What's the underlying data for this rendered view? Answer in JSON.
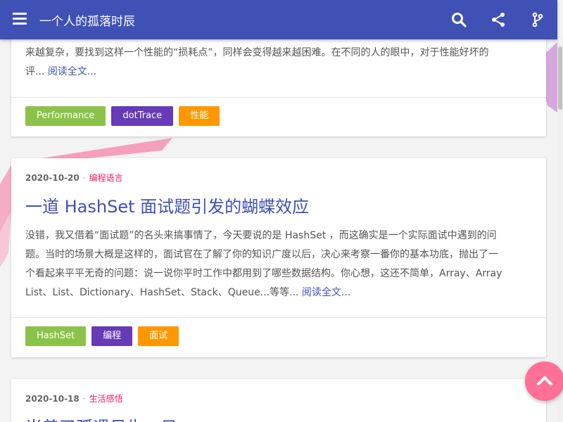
{
  "nav": {
    "title": "一个人的孤落时辰"
  },
  "icons": {
    "menu": "menu-icon",
    "search": "search-icon",
    "share": "share-icon",
    "git": "git-branch-icon",
    "back_to_top": "chevron-up-icon"
  },
  "colors": {
    "primary": "#3f51b5",
    "accent": "#e91e63",
    "tag_green": "#8bc34a",
    "tag_purple": "#673ab7",
    "tag_orange": "#ff9800",
    "fab": "#ff6f96"
  },
  "posts": [
    {
      "excerpt_lines": [
        "来越复杂，要找到这样一个性能的“损耗点”，同样会变得越来越困难。在不同的人的眼中，对于性能好坏的",
        "评..."
      ],
      "read_more": "阅读全文...",
      "tags": [
        "Performance",
        "dotTrace",
        "性能"
      ]
    },
    {
      "date": "2020-10-20",
      "category": "编程语言",
      "title": "一道 HashSet 面试题引发的蝴蝶效应",
      "excerpt_lines": [
        "没错，我又借着“面试题”的名头来搞事情了，今天要说的是 HashSet ，而这确实是一个实际面试中遇到的问",
        "题。当时的场景大概是这样的，面试官在了解了你的知识广度以后，决心来考察一番你的基本功底，抛出了一",
        "个看起来平平无奇的问题：说一说你平时工作中都用到了哪些数据结构。你心想，这还不简单，Array、Array",
        "List、List、Dictionary、HashSet、Stack、Queue...等等..."
      ],
      "read_more": "阅读全文...",
      "tags": [
        "HashSet",
        "编程",
        "面试"
      ]
    },
    {
      "date": "2020-10-18",
      "category": "生活感悟",
      "title": "当善了孤遇见生一日"
    }
  ]
}
